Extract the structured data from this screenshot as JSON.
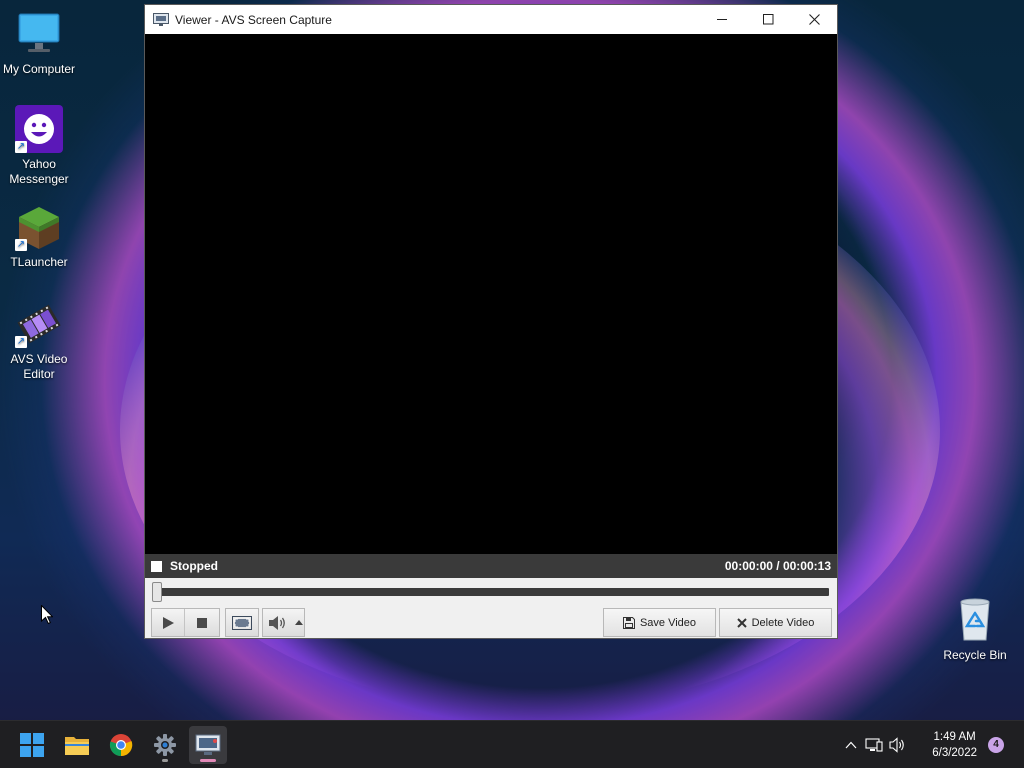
{
  "desktop": {
    "icons": [
      {
        "label": "My Computer"
      },
      {
        "label": "Yahoo Messenger"
      },
      {
        "label": "TLauncher"
      },
      {
        "label": "AVS Video Editor"
      },
      {
        "label": "Recycle Bin"
      }
    ]
  },
  "window": {
    "title": "Viewer - AVS Screen Capture",
    "status": "Stopped",
    "time_current": "00:00:00",
    "time_separator": "/",
    "time_total": "00:00:13",
    "seek_position": 0,
    "save_label": "Save Video",
    "delete_label": "Delete Video"
  },
  "taskbar": {
    "clock_time": "1:49 AM",
    "clock_date": "6/3/2022",
    "notification_count": "4"
  },
  "colors": {
    "titlebar_bg": "#ffffff",
    "video_bg": "#000000",
    "status_bg": "#3a3a3a",
    "controls_bg": "#f0f0f0",
    "taskbar_bg": "#1f1f22",
    "accent_pink": "#e38ab8"
  }
}
